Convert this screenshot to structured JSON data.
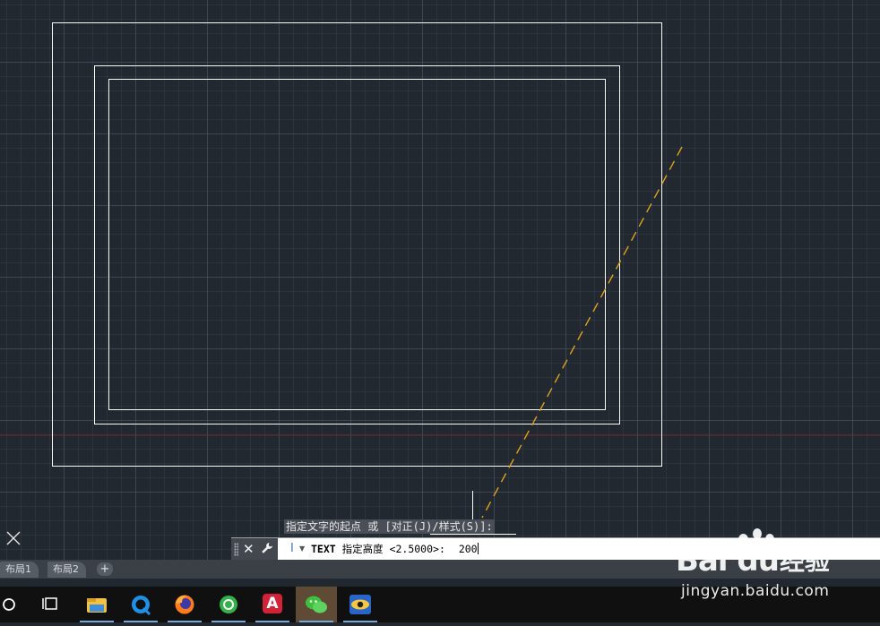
{
  "canvas": {
    "background": "#212830",
    "line_color": "#ffffff",
    "tracking_line_color": "#e0a020"
  },
  "prompt": {
    "hint": "指定文字的起点 或 [对正(J)/样式(S)]:",
    "command": "TEXT",
    "message": "指定高度 <2.5000>:",
    "input_value": "200"
  },
  "icons": {
    "close": "close-icon",
    "customize": "wrench-icon",
    "command": "text-cursor-icon",
    "ucs": "ucs-icon"
  },
  "layout_tabs": {
    "items": [
      {
        "label": "布局1"
      },
      {
        "label": "布局2"
      }
    ],
    "add_label": "+"
  },
  "taskbar": {
    "items": [
      {
        "name": "cortana-icon"
      },
      {
        "name": "task-view-icon"
      },
      {
        "name": "file-explorer-icon"
      },
      {
        "name": "browser-icon"
      },
      {
        "name": "firefox-icon"
      },
      {
        "name": "green-app-icon"
      },
      {
        "name": "autocad-icon"
      },
      {
        "name": "wechat-icon"
      },
      {
        "name": "eye-app-icon"
      }
    ],
    "autocad_letter": "A"
  },
  "watermark": {
    "logo": "Bai du",
    "cn": "经验",
    "url": "jingyan.baidu.com"
  }
}
